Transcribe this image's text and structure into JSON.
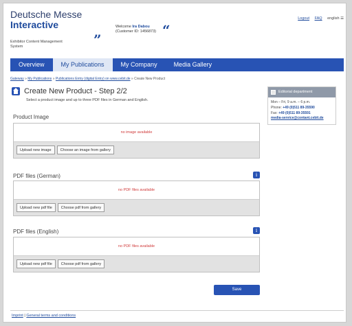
{
  "header": {
    "brand_line1": "Deutsche Messe",
    "brand_line2": "Interactive",
    "brand_sub": "Exhibitor Content Management System",
    "welcome_prefix": "Welcome ",
    "welcome_name": "Ira Dabou",
    "customer_id": "(Customer ID: 1456873)",
    "links": {
      "logout": "Logout",
      "faq": "FAQ",
      "language": "english ☰"
    }
  },
  "nav": {
    "tabs": [
      {
        "label": "Overview"
      },
      {
        "label": "My Publications"
      },
      {
        "label": "My Company"
      },
      {
        "label": "Media Gallery"
      }
    ]
  },
  "breadcrumb": {
    "items": [
      "Gateway",
      "My Publications",
      "Publications Entry (digital Entry) on www.cebit.de"
    ],
    "current": "Create New Product"
  },
  "page": {
    "title": "Create New Product - Step 2/2",
    "subtitle": "Select a product image and up to three PDF files in German and English."
  },
  "sections": {
    "image": {
      "label": "Product Image",
      "empty": "no image available",
      "btn_upload": "Upload new image",
      "btn_gallery": "Choose an image from gallery"
    },
    "pdf_de": {
      "label": "PDF files (German)",
      "empty": "no PDF files available",
      "btn_upload": "Upload new pdf file",
      "btn_gallery": "Choose pdf from gallery"
    },
    "pdf_en": {
      "label": "PDF files (English)",
      "empty": "no PDF files available",
      "btn_upload": "Upload new pdf file",
      "btn_gallery": "Choose pdf from gallery"
    },
    "info_icon": "i"
  },
  "save_label": "Save",
  "sidebar": {
    "title": "Editorial department",
    "hours": "Mon – Fri, 9 a.m. – 6 p.m.",
    "phone_label": "Phone: ",
    "phone": "+49 (0)511 89-35590",
    "fax_label": "Fax: ",
    "fax": "+49 (0)511 89-35591",
    "email": "media-service@contant.cebit.de"
  },
  "footer": {
    "imprint": "Imprint",
    "sep": " | ",
    "terms": "General terms and conditions"
  },
  "colors": {
    "accent": "#2853b4",
    "error": "#d03a3a"
  }
}
